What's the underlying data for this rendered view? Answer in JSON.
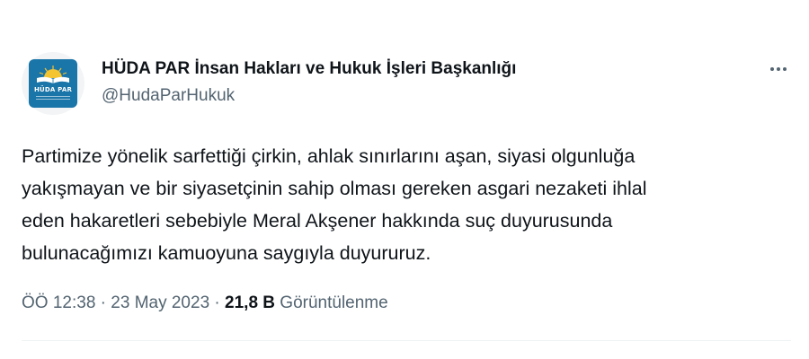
{
  "account": {
    "display_name": "HÜDA PAR İnsan Hakları ve Hukuk İşleri Başkanlığı",
    "handle": "@HudaParHukuk",
    "avatar_text": "HÜDA PAR",
    "avatar_color": "#1a75a8"
  },
  "more_menu_icon": "ellipsis-horizontal-icon",
  "tweet": {
    "lines": [
      "Partimize yönelik sarfettiği çirkin, ahlak sınırlarını aşan, siyasi olgunluğa",
      "yakışmayan ve bir siyasetçinin sahip olması gereken asgari nezaketi ihlal",
      "eden hakaretleri sebebiyle Meral Akşener hakkında suç duyurusunda",
      "bulunacağımızı kamuoyuna saygıyla duyururuz."
    ]
  },
  "meta": {
    "time": "ÖÖ 12:38",
    "separator": " · ",
    "date": "23 May 2023",
    "views_count": "21,8 B",
    "views_label": "Görüntülenme"
  },
  "colors": {
    "text_primary": "#0f1419",
    "text_secondary": "#536471",
    "divider": "#eff3f4"
  }
}
